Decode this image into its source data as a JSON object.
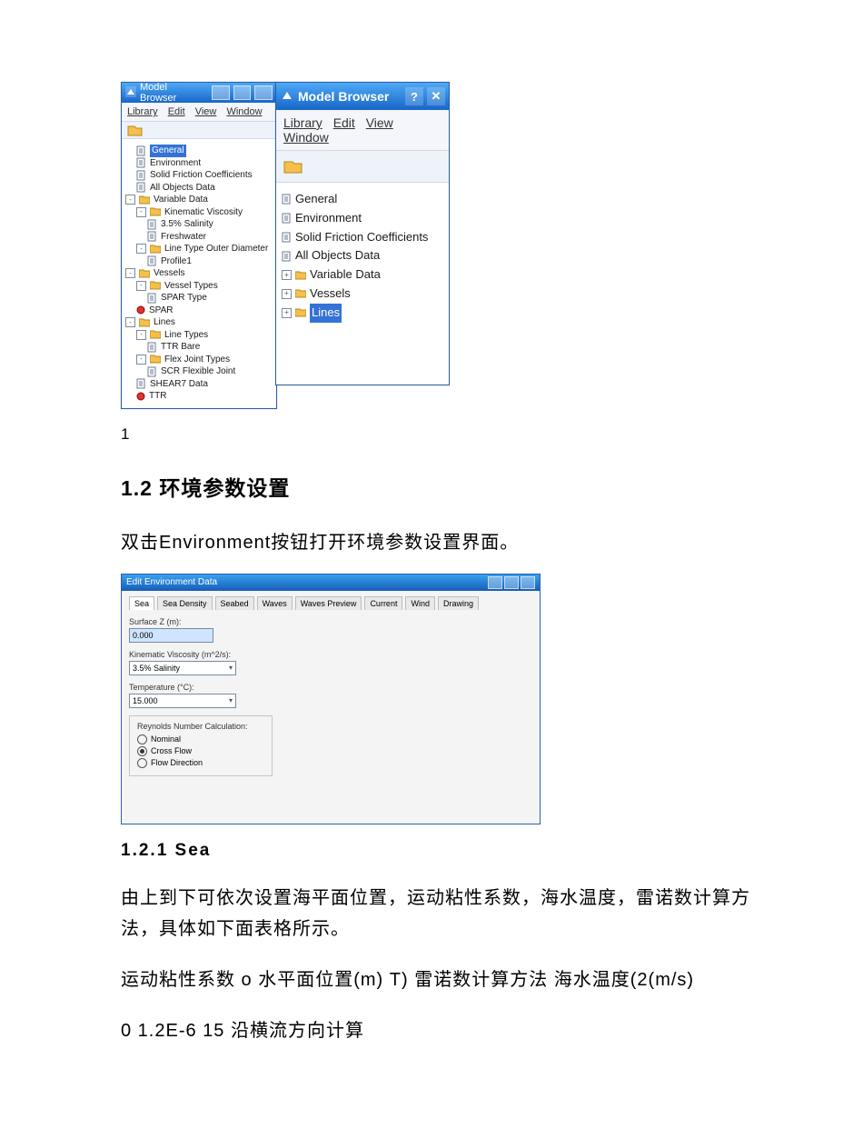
{
  "fig_left": {
    "title": "Model Browser",
    "menus": [
      "Library",
      "Edit",
      "View",
      "Window"
    ],
    "tree": [
      {
        "label": "General",
        "type": "doc",
        "sel": true,
        "lvl": 1
      },
      {
        "label": "Environment",
        "type": "doc",
        "lvl": 1
      },
      {
        "label": "Solid Friction Coefficients",
        "type": "doc",
        "lvl": 1
      },
      {
        "label": "All Objects Data",
        "type": "doc",
        "lvl": 1
      },
      {
        "label": "Variable Data",
        "type": "fold",
        "exp": "-",
        "lvl": 0
      },
      {
        "label": "Kinematic Viscosity",
        "type": "fold",
        "exp": "-",
        "lvl": 1
      },
      {
        "label": "3.5% Salinity",
        "type": "doc",
        "lvl": 2
      },
      {
        "label": "Freshwater",
        "type": "doc",
        "lvl": 2
      },
      {
        "label": "Line Type Outer Diameter",
        "type": "fold",
        "exp": "-",
        "lvl": 1
      },
      {
        "label": "Profile1",
        "type": "doc",
        "lvl": 2
      },
      {
        "label": "Vessels",
        "type": "fold",
        "exp": "-",
        "lvl": 0
      },
      {
        "label": "Vessel Types",
        "type": "fold",
        "exp": "-",
        "lvl": 1
      },
      {
        "label": "SPAR Type",
        "type": "doc",
        "lvl": 2
      },
      {
        "label": "SPAR",
        "type": "obj",
        "lvl": 1
      },
      {
        "label": "Lines",
        "type": "fold",
        "exp": "-",
        "lvl": 0
      },
      {
        "label": "Line Types",
        "type": "fold",
        "exp": "-",
        "lvl": 1
      },
      {
        "label": "TTR Bare",
        "type": "doc",
        "lvl": 2
      },
      {
        "label": "Flex Joint Types",
        "type": "fold",
        "exp": "-",
        "lvl": 1
      },
      {
        "label": "SCR Flexible Joint",
        "type": "doc",
        "lvl": 2
      },
      {
        "label": "SHEAR7 Data",
        "type": "doc",
        "lvl": 1
      },
      {
        "label": "TTR",
        "type": "obj",
        "lvl": 1
      }
    ]
  },
  "fig_right": {
    "title": "Model Browser",
    "menus": [
      "Library",
      "Edit",
      "View",
      "Window"
    ],
    "tree": [
      {
        "label": "General",
        "type": "doc"
      },
      {
        "label": "Environment",
        "type": "doc"
      },
      {
        "label": "Solid Friction Coefficients",
        "type": "doc"
      },
      {
        "label": "All Objects Data",
        "type": "doc"
      },
      {
        "label": "Variable Data",
        "type": "fold",
        "exp": "+"
      },
      {
        "label": "Vessels",
        "type": "fold",
        "exp": "+"
      },
      {
        "label": "Lines",
        "type": "fold",
        "exp": "+",
        "sel": true
      }
    ]
  },
  "caption1": "1",
  "h2": "1.2 环境参数设置",
  "p_open": "双击Environment按钮打开环境参数设置界面。",
  "env": {
    "title": "Edit Environment Data",
    "tabs": [
      "Sea",
      "Sea Density",
      "Seabed",
      "Waves",
      "Waves Preview",
      "Current",
      "Wind",
      "Drawing"
    ],
    "surface_label": "Surface Z (m):",
    "surface_value": "0.000",
    "visc_label": "Kinematic Viscosity (m^2/s):",
    "visc_value": "3.5% Salinity",
    "temp_label": "Temperature (°C):",
    "temp_value": "15.000",
    "group_label": "Reynolds Number Calculation:",
    "radios": [
      "Nominal",
      "Cross Flow",
      "Flow Direction"
    ],
    "radio_selected": 1
  },
  "h3": "1.2.1 Sea",
  "p_sea": "由上到下可依次设置海平面位置，运动粘性系数，海水温度，雷诺数计算方法，具体如下面表格所示。",
  "p_tblhead": "运动粘性系数 o 水平面位置(m) T) 雷诺数计算方法 海水温度(2(m/s)",
  "p_tblrow": "0 1.2E-6 15 沿横流方向计算"
}
